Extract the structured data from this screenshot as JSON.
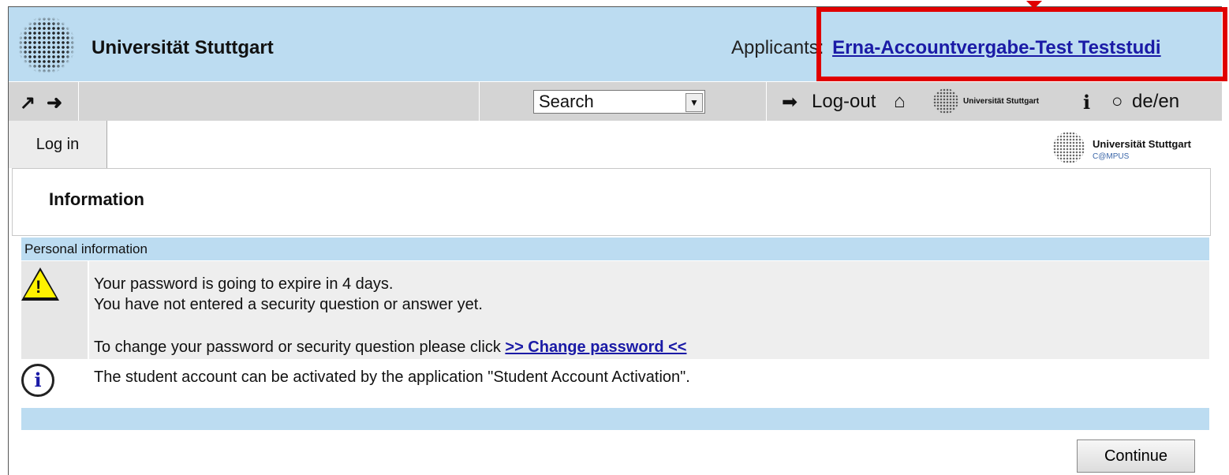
{
  "header": {
    "university_name": "Universität Stuttgart",
    "applicants_label": "Applicants:",
    "user_link": "Erna-Accountvergabe-Test Teststudi"
  },
  "toolbar": {
    "search_selected": "Search",
    "logout_label": "Log-out",
    "language_label": "de/en",
    "mini_logo_text": "Universität Stuttgart"
  },
  "tabs": [
    {
      "label": "Log in"
    }
  ],
  "campus": {
    "name": "Universität Stuttgart",
    "sub": "C@MPUS"
  },
  "page_title": "Information",
  "personal_info": {
    "heading": "Personal information",
    "line1": "Your password is going to expire in 4 days.",
    "line2": "You have not entered a security question or answer yet.",
    "line3_prefix": "To change your password or security question please click",
    "change_link": ">> Change password <<",
    "activation_text": "The student account can be activated by the application \"Student Account Activation\"."
  },
  "buttons": {
    "continue": "Continue"
  },
  "colors": {
    "accent_blue": "#bcdcf1",
    "link": "#1a1aa6",
    "highlight": "#e00000"
  }
}
